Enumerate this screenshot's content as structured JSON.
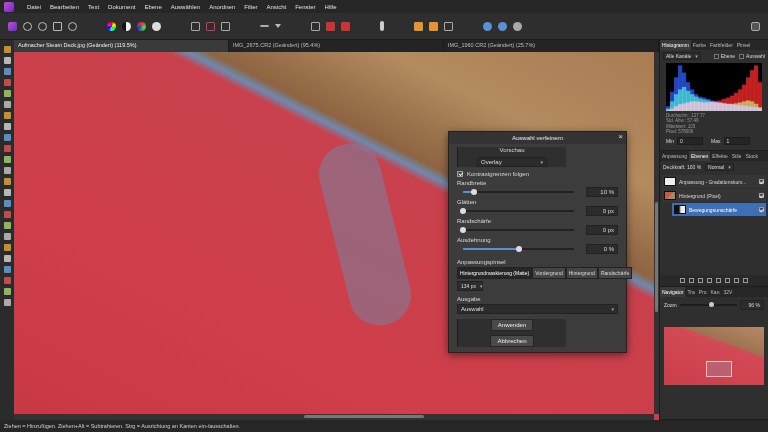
{
  "menu": [
    "Datei",
    "Bearbeiten",
    "Text",
    "Dokument",
    "Ebene",
    "Auswählen",
    "Anordnen",
    "Filter",
    "Ansicht",
    "Fenster",
    "Hilfe"
  ],
  "doc_tabs": [
    {
      "label": "Aufmacher Steam Deck.jpg (Geändert) (119.5%)",
      "selected": true
    },
    {
      "label": "IMG_2675.CR2 (Geändert) (95.4%)",
      "selected": false
    },
    {
      "label": "IMG_1960.CR2 (Geändert) (25.7%)",
      "selected": false
    }
  ],
  "dialog": {
    "title": "Auswahl verfeinern",
    "close": "×",
    "preview": {
      "label": "Vorschau",
      "value": "Overlay"
    },
    "follow_edges": {
      "label": "Kontrastgrenzen folgen",
      "checked": true
    },
    "sliders": [
      {
        "label": "Randbreite",
        "level": 0.1,
        "reading": "10 %"
      },
      {
        "label": "Glätten",
        "level": 0.0,
        "reading": "0 px"
      },
      {
        "label": "Randschärfe",
        "level": 0.0,
        "reading": "0 px"
      },
      {
        "label": "Ausdehnung",
        "level": 0.5,
        "reading": "0 %"
      }
    ],
    "brush": {
      "label": "Anpassungspinsel",
      "modes": [
        {
          "label": "Hintergrundmaskierung (Matte)",
          "selected": true
        },
        {
          "label": "Vordergrund",
          "selected": false
        },
        {
          "label": "Hintergrund",
          "selected": false
        },
        {
          "label": "Randschärfe",
          "selected": false
        }
      ],
      "size": "134 px"
    },
    "output": {
      "label": "Ausgabe",
      "value": "Auswahl"
    },
    "buttons": [
      "Anwenden",
      "Abbrechen"
    ]
  },
  "histogram_panel": {
    "tabs": [
      {
        "label": "Histogramm",
        "selected": true
      },
      {
        "label": "Farbe",
        "selected": false
      },
      {
        "label": "Farbfelder",
        "selected": false
      },
      {
        "label": "Pinsel",
        "selected": false
      }
    ],
    "channel": "Alle Kanäle",
    "options": [
      {
        "label": "Ebene",
        "checked": false
      },
      {
        "label": "Auswahl",
        "checked": false
      }
    ],
    "series": [
      {
        "name": "blue",
        "color": "#2f5bff",
        "values": [
          10,
          40,
          70,
          95,
          80,
          60,
          45,
          35,
          30,
          28,
          25,
          22,
          20,
          18,
          16,
          15,
          14,
          13,
          12,
          11,
          10,
          9,
          8,
          6
        ]
      },
      {
        "name": "green",
        "color": "#2fd05a",
        "values": [
          5,
          20,
          35,
          45,
          50,
          42,
          35,
          30,
          26,
          24,
          22,
          20,
          18,
          17,
          16,
          15,
          15,
          16,
          18,
          20,
          22,
          20,
          15,
          8
        ]
      },
      {
        "name": "red",
        "color": "#ff2a2a",
        "values": [
          2,
          5,
          10,
          14,
          16,
          18,
          20,
          20,
          19,
          18,
          18,
          19,
          20,
          22,
          25,
          28,
          32,
          38,
          45,
          55,
          70,
          85,
          95,
          60
        ]
      }
    ],
    "stats": [
      "Durchschn.: 127.77",
      "Std. Abw.: 57.49",
      "Mittelwert: 103",
      "Pixel: 578006"
    ],
    "min": {
      "label": "Min",
      "value": "0"
    },
    "max": {
      "label": "Max",
      "value": "1"
    }
  },
  "layers_panel": {
    "tabs": [
      {
        "label": "Anpassung",
        "selected": false
      },
      {
        "label": "Ebenen",
        "selected": true
      },
      {
        "label": "Effekte",
        "selected": false
      },
      {
        "label": "Stile",
        "selected": false
      },
      {
        "label": "Stock",
        "selected": false
      }
    ],
    "opacity": "Deckkraft: 100 %",
    "blend": "Normal",
    "layers": [
      {
        "name": "Anpassung - Gradationskurv...",
        "kind": "adjustment",
        "visible": true,
        "selected": false
      },
      {
        "name": "Hintergrund (Pixel)",
        "kind": "pixel",
        "visible": true,
        "selected": false
      },
      {
        "name": "Bewegungsunschärfe",
        "kind": "filter",
        "visible": true,
        "selected": true
      }
    ]
  },
  "navigator_panel": {
    "tabs": [
      {
        "label": "Navigator",
        "selected": true
      },
      {
        "label": "Tra",
        "selected": false
      },
      {
        "label": "Pro",
        "selected": false
      },
      {
        "label": "Kan",
        "selected": false
      },
      {
        "label": "32V",
        "selected": false
      }
    ],
    "zoom_label": "Zoom",
    "zoom_value": "96 %",
    "zoom_level": 0.55
  },
  "status_bar": "Ziehen = Hinzufügen. Ziehen+Alt = Subtrahieren. Strg = Ausrichtung an Kanten ein-/ausschalten."
}
